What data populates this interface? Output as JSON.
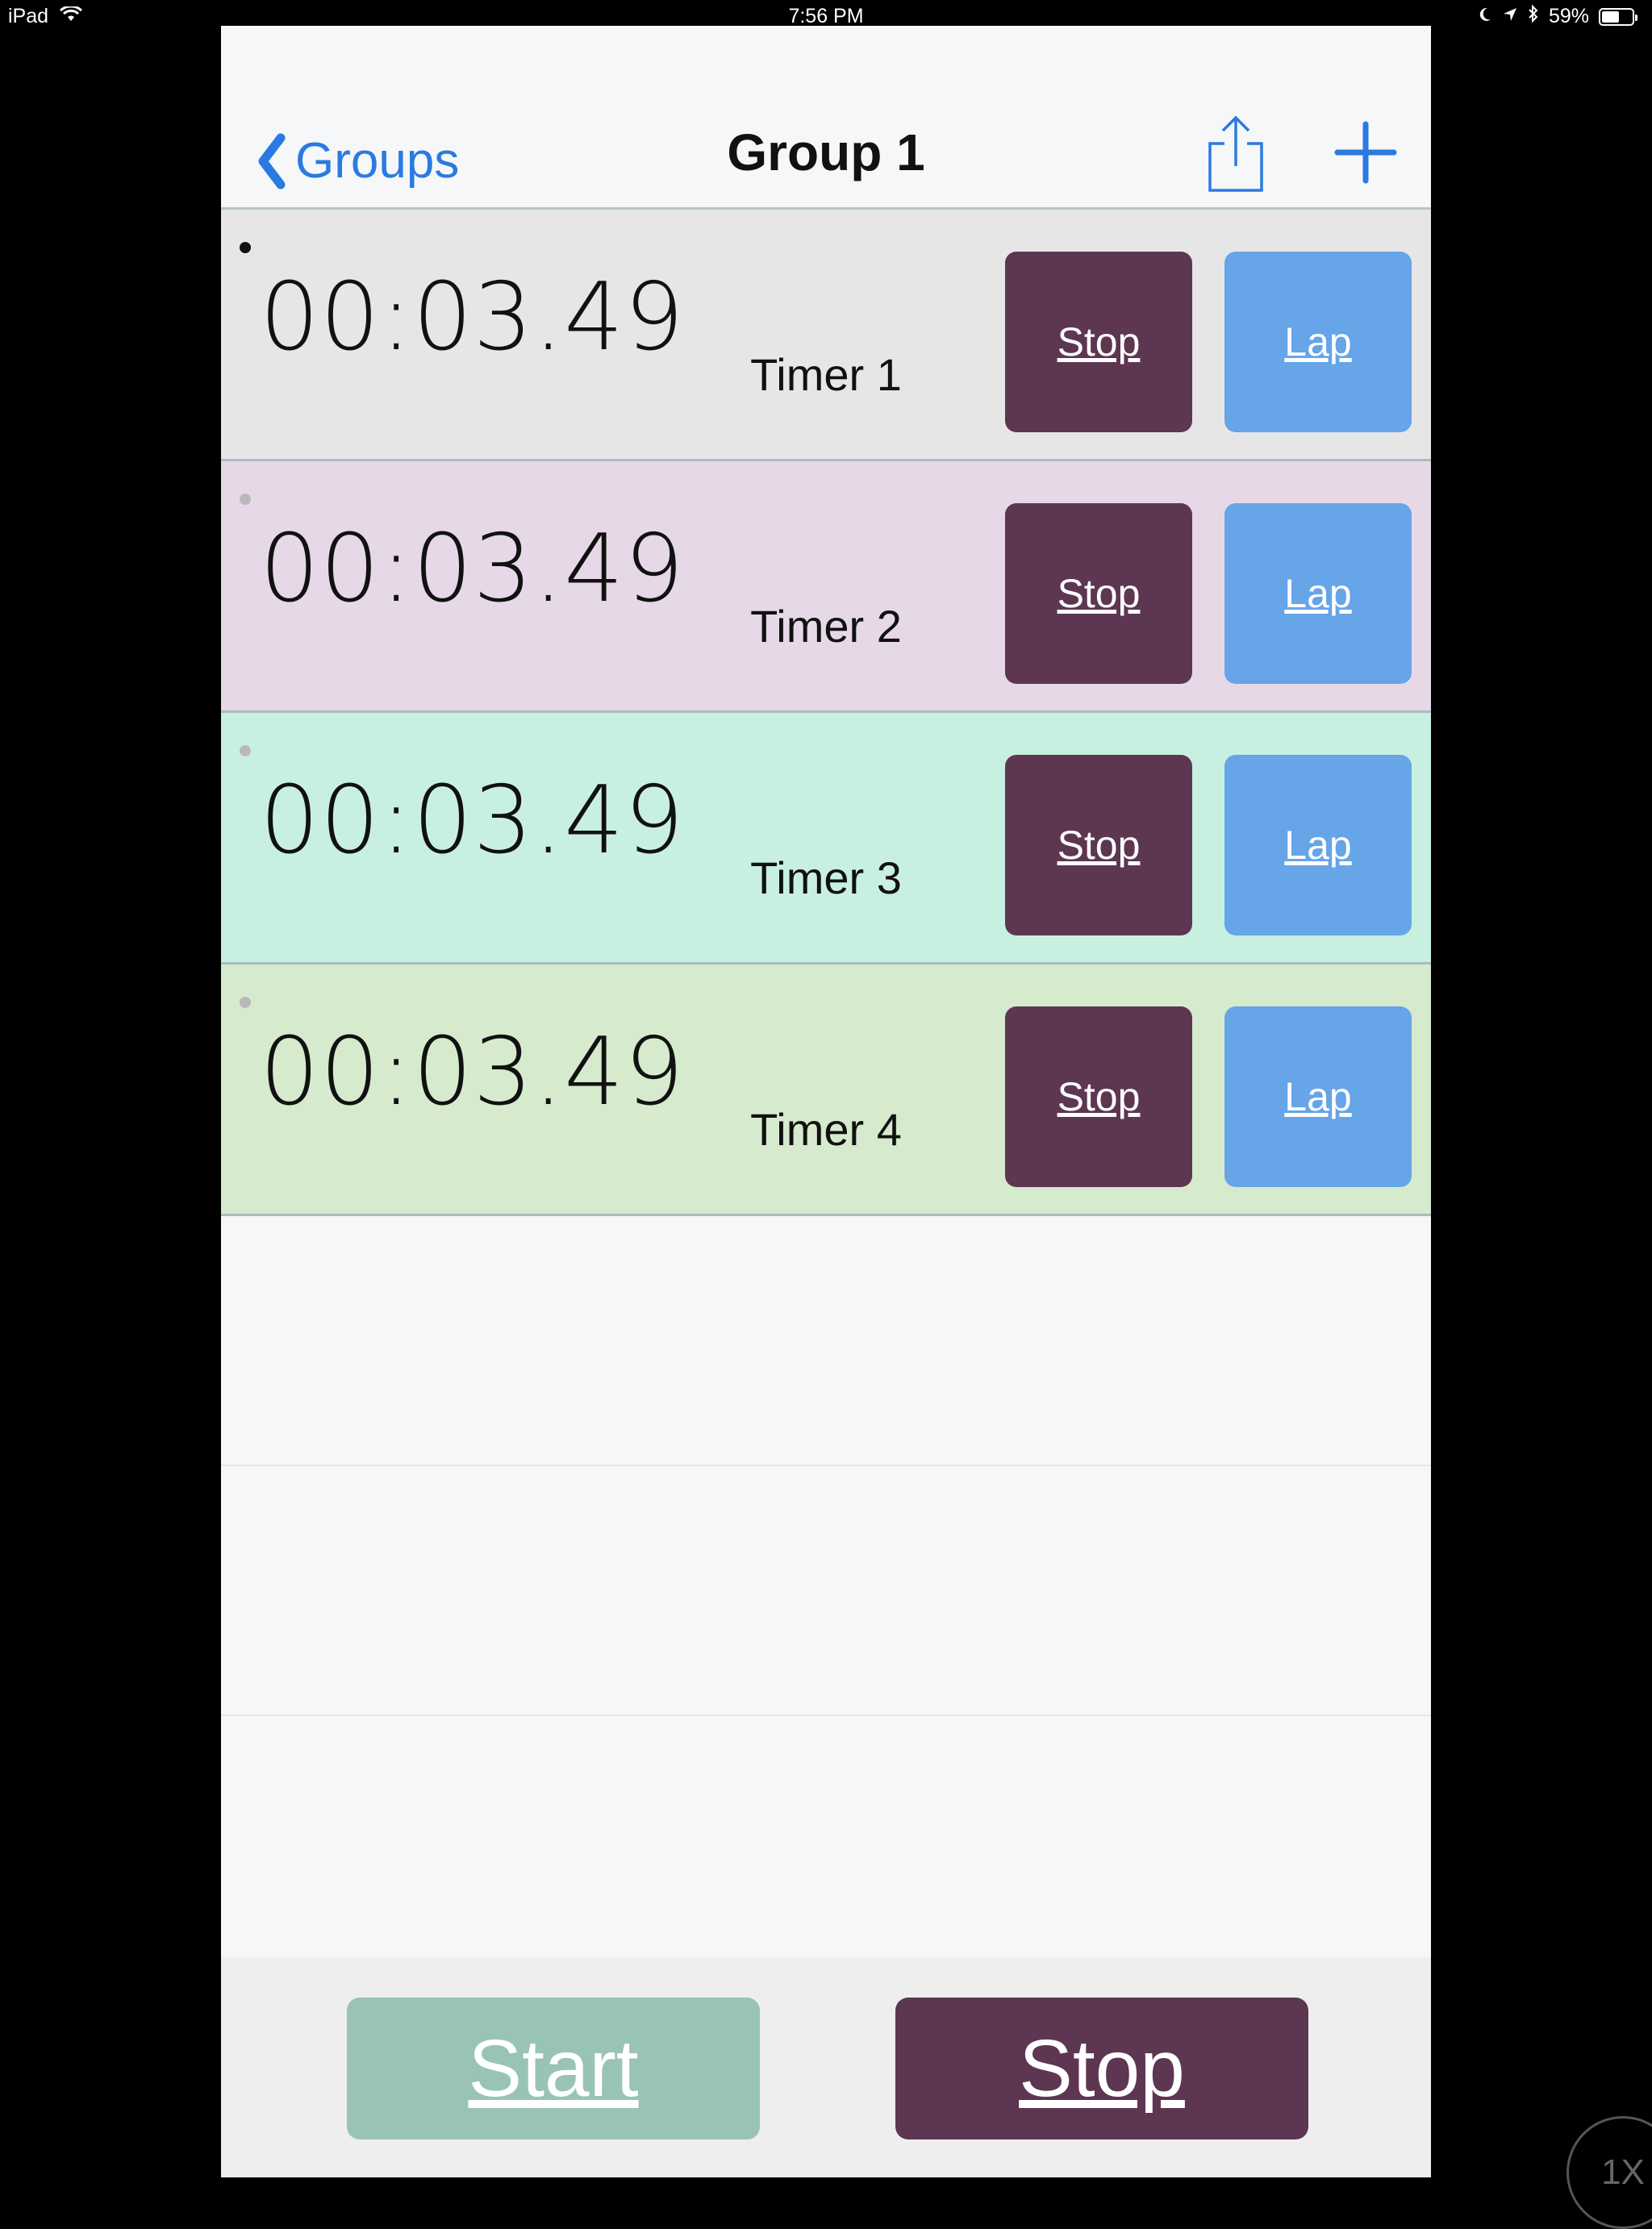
{
  "status_bar": {
    "device": "iPad",
    "time": "7:56 PM",
    "battery_percent": "59%",
    "battery_level": 0.59,
    "icons": [
      "wifi-icon",
      "moon-icon",
      "location-icon",
      "bluetooth-icon",
      "battery-icon"
    ]
  },
  "nav": {
    "back_label": "Groups",
    "title": "Group 1",
    "accent_color": "#2a7ae2"
  },
  "timers": [
    {
      "time": "00:03.49",
      "label": "Timer 1",
      "stop_label": "Stop",
      "lap_label": "Lap",
      "bg": "#e6e6e6",
      "active": true
    },
    {
      "time": "00:03.49",
      "label": "Timer 2",
      "stop_label": "Stop",
      "lap_label": "Lap",
      "bg": "#e6d8e6",
      "active": false
    },
    {
      "time": "00:03.49",
      "label": "Timer 3",
      "stop_label": "Stop",
      "lap_label": "Lap",
      "bg": "#c8f0e1",
      "active": false
    },
    {
      "time": "00:03.49",
      "label": "Timer 4",
      "stop_label": "Stop",
      "lap_label": "Lap",
      "bg": "#d6eacd",
      "active": false
    }
  ],
  "footer": {
    "start_label": "Start",
    "stop_label": "Stop",
    "start_color": "#99c3b7",
    "stop_color": "#5d3652"
  },
  "zoom_label": "1X",
  "colors": {
    "stop_button": "#5d3652",
    "lap_button": "#65a5e8"
  }
}
